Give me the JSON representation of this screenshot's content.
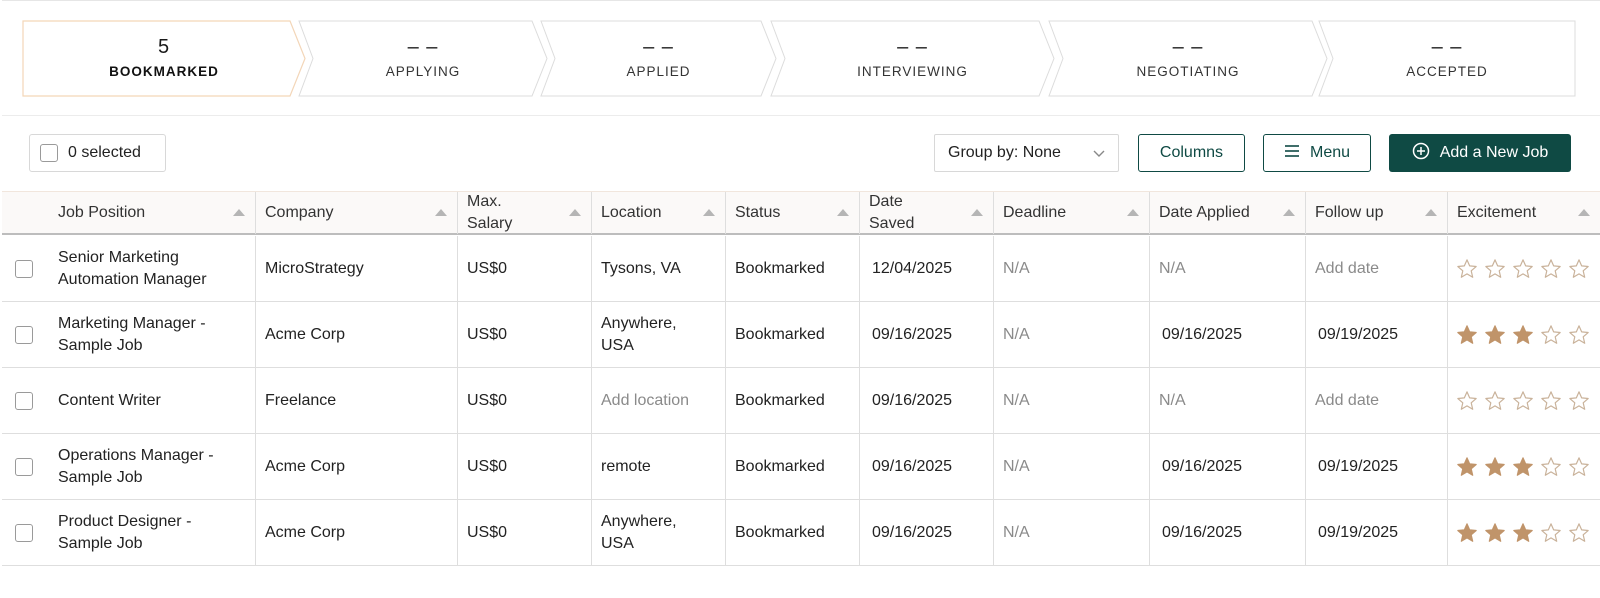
{
  "pipeline": {
    "stages": [
      {
        "count": "5",
        "label": "BOOKMARKED"
      },
      {
        "count": "– –",
        "label": "APPLYING"
      },
      {
        "count": "– –",
        "label": "APPLIED"
      },
      {
        "count": "– –",
        "label": "INTERVIEWING"
      },
      {
        "count": "– –",
        "label": "NEGOTIATING"
      },
      {
        "count": "– –",
        "label": "ACCEPTED"
      }
    ]
  },
  "toolbar": {
    "selected_label": "0 selected",
    "group_by": "Group by: None",
    "columns_label": "Columns",
    "menu_label": "Menu",
    "add_label": "Add a New Job"
  },
  "table": {
    "headers": [
      "Job Position",
      "Company",
      "Max. Salary",
      "Location",
      "Status",
      "Date Saved",
      "Deadline",
      "Date Applied",
      "Follow up",
      "Excitement"
    ],
    "rows": [
      {
        "position": "Senior Marketing Automation Manager",
        "company": "MicroStrategy",
        "salary": "US$0",
        "location": "Tysons, VA",
        "status": "Bookmarked",
        "date_saved": "12/04/2025",
        "deadline": "N/A",
        "date_applied": "N/A",
        "follow_up": "Add date",
        "excitement": 0
      },
      {
        "position": "Marketing Manager - Sample Job",
        "company": "Acme Corp",
        "salary": "US$0",
        "location": "Anywhere, USA",
        "status": "Bookmarked",
        "date_saved": "09/16/2025",
        "deadline": "N/A",
        "date_applied": "09/16/2025",
        "follow_up": "09/19/2025",
        "excitement": 3
      },
      {
        "position": "Content Writer",
        "company": "Freelance",
        "salary": "US$0",
        "location": "Add location",
        "status": "Bookmarked",
        "date_saved": "09/16/2025",
        "deadline": "N/A",
        "date_applied": "N/A",
        "follow_up": "Add date",
        "excitement": 0
      },
      {
        "position": "Operations Manager - Sample Job",
        "company": "Acme Corp",
        "salary": "US$0",
        "location": "remote",
        "status": "Bookmarked",
        "date_saved": "09/16/2025",
        "deadline": "N/A",
        "date_applied": "09/16/2025",
        "follow_up": "09/19/2025",
        "excitement": 3
      },
      {
        "position": "Product Designer - Sample Job",
        "company": "Acme Corp",
        "salary": "US$0",
        "location": "Anywhere, USA",
        "status": "Bookmarked",
        "date_saved": "09/16/2025",
        "deadline": "N/A",
        "date_applied": "09/16/2025",
        "follow_up": "09/19/2025",
        "excitement": 3
      }
    ]
  },
  "colors": {
    "accent": "#0f4a44",
    "star_filled": "#c0946a",
    "star_empty": "#c9b29a",
    "active_stage_border": "#f3d6b8"
  },
  "icons": {
    "group_by": "chevron-down-icon",
    "menu": "hamburger-icon",
    "add": "plus-circle-icon",
    "sort": "sort-up-icon",
    "excitement": "star-icon"
  }
}
